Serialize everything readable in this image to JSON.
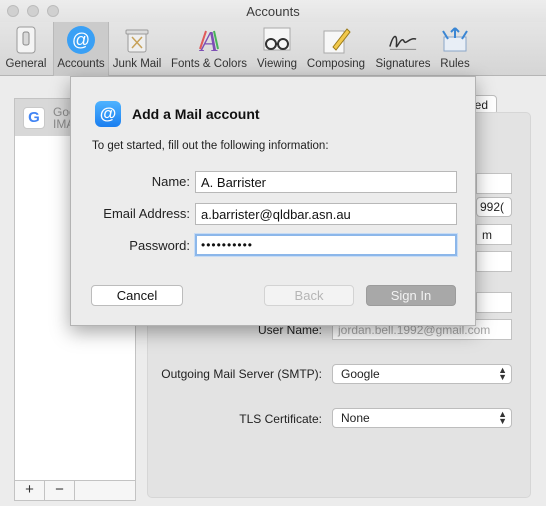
{
  "window": {
    "title": "Accounts"
  },
  "toolbar": {
    "tabs": [
      {
        "label": "General",
        "icon": "general-switch-icon"
      },
      {
        "label": "Accounts",
        "icon": "at-sign-icon",
        "selected": true
      },
      {
        "label": "Junk Mail",
        "icon": "trash-icon"
      },
      {
        "label": "Fonts & Colors",
        "icon": "fonts-colors-icon"
      },
      {
        "label": "Viewing",
        "icon": "glasses-icon"
      },
      {
        "label": "Composing",
        "icon": "pencil-icon"
      },
      {
        "label": "Signatures",
        "icon": "signature-icon"
      },
      {
        "label": "Rules",
        "icon": "rules-arrows-icon"
      }
    ]
  },
  "accounts": {
    "list": [
      {
        "name": "Goo",
        "type": "IMA",
        "icon": "google-icon"
      }
    ],
    "add_label": "+",
    "remove_label": "−"
  },
  "detail": {
    "tab_fragment": "ed",
    "port_fragment": "992(",
    "host_fragment": "m",
    "user_name_label": "User Name:",
    "user_name_value": "jordan.bell.1992@gmail.com",
    "smtp_label": "Outgoing Mail Server (SMTP):",
    "smtp_value": "Google",
    "tls_label": "TLS Certificate:",
    "tls_value": "None"
  },
  "sheet": {
    "title": "Add a Mail account",
    "subtitle": "To get started, fill out the following information:",
    "name_label": "Name:",
    "name_value": "A. Barrister",
    "email_label": "Email Address:",
    "email_value": "a.barrister@qldbar.asn.au",
    "password_label": "Password:",
    "password_value": "••••••••••",
    "cancel_label": "Cancel",
    "back_label": "Back",
    "signin_label": "Sign In"
  }
}
